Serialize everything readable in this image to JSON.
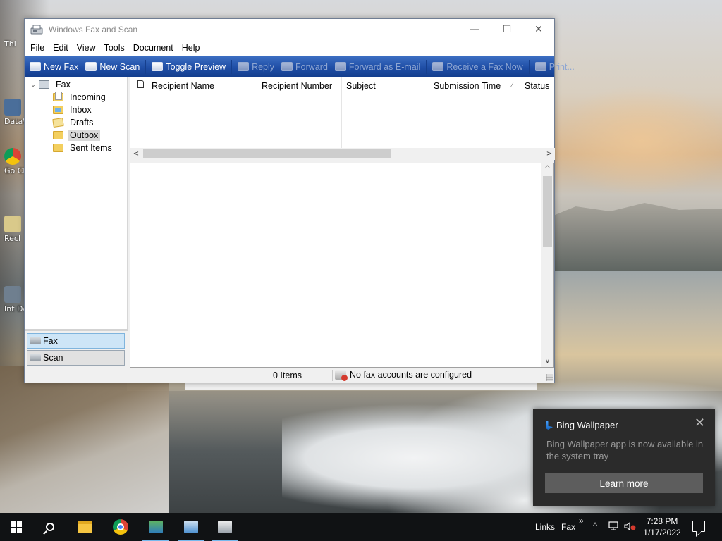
{
  "window": {
    "title": "Windows Fax and Scan",
    "controls": {
      "minimize": "—",
      "maximize": "☐",
      "close": "✕"
    }
  },
  "menubar": [
    "File",
    "Edit",
    "View",
    "Tools",
    "Document",
    "Help"
  ],
  "toolbar": {
    "new_fax": "New Fax",
    "new_scan": "New Scan",
    "toggle_preview": "Toggle Preview",
    "reply": "Reply",
    "forward": "Forward",
    "forward_email": "Forward as E-mail",
    "receive": "Receive a Fax Now",
    "print": "Print..."
  },
  "tree": {
    "root": "Fax",
    "expander": "⌄",
    "items": [
      "Incoming",
      "Inbox",
      "Drafts",
      "Outbox",
      "Sent Items"
    ],
    "selected": "Outbox"
  },
  "nav_panel": {
    "fax": "Fax",
    "scan": "Scan"
  },
  "list": {
    "columns": [
      "Recipient Name",
      "Recipient Number",
      "Subject",
      "Submission Time",
      "Status"
    ],
    "sort_indicator": "⁄",
    "rows": []
  },
  "scroll": {
    "left": "<",
    "right": ">",
    "up": "^",
    "down": "v"
  },
  "statusbar": {
    "items": "0 Items",
    "message": "No fax accounts are configured"
  },
  "toast": {
    "app": "Bing Wallpaper",
    "body": "Bing Wallpaper app is now available in the system tray",
    "button": "Learn more",
    "close": "✕"
  },
  "taskbar": {
    "links": "Links",
    "fax": "Fax",
    "overflow": "»",
    "chevron": "^",
    "time": "7:28 PM",
    "date": "1/17/2022"
  },
  "desktop_icons": [
    "Thi",
    "DataW",
    "Go Chr",
    "Recl",
    "Int Dow"
  ],
  "colors": {
    "toolbar_blue": "#1f4ea6",
    "nav_selected": "#cde5f7",
    "toast_bg": "#2b2b2b",
    "taskbar_bg": "#101214"
  }
}
